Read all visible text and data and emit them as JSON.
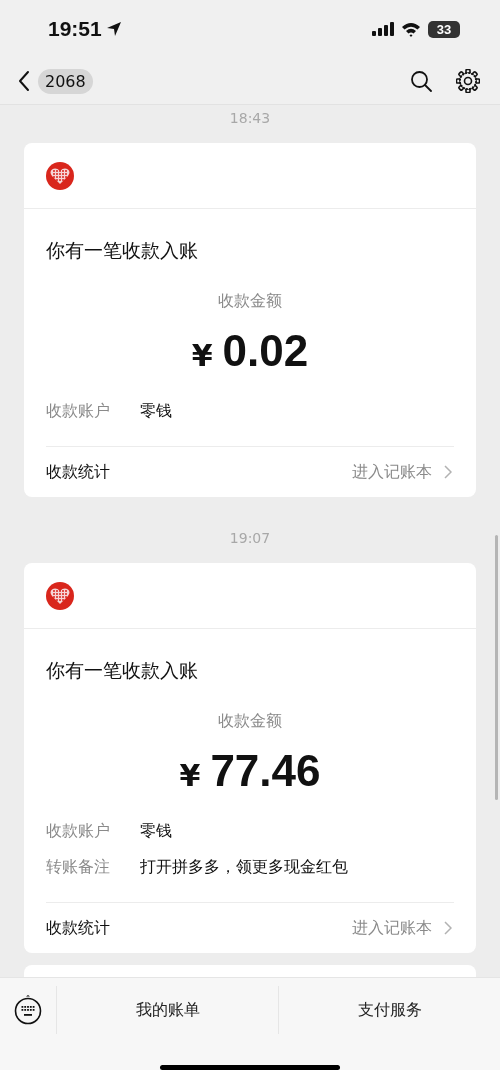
{
  "status_bar": {
    "time": "19:51",
    "battery": "33"
  },
  "nav": {
    "badge": "2068"
  },
  "messages": [
    {
      "time": "18:43",
      "title": "你有一笔收款入账",
      "amount_label": "收款金额",
      "currency": "¥",
      "amount": "0.02",
      "rows": [
        {
          "label": "收款账户",
          "value": "零钱"
        }
      ],
      "footer_label": "收款统计",
      "footer_link": "进入记账本"
    },
    {
      "time": "19:07",
      "title": "你有一笔收款入账",
      "amount_label": "收款金额",
      "currency": "¥",
      "amount": "77.46",
      "rows": [
        {
          "label": "收款账户",
          "value": "零钱"
        },
        {
          "label": "转账备注",
          "value": "打开拼多多，领更多现金红包"
        }
      ],
      "footer_label": "收款统计",
      "footer_link": "进入记账本"
    }
  ],
  "bottom_menu": [
    "我的账单",
    "支付服务"
  ]
}
